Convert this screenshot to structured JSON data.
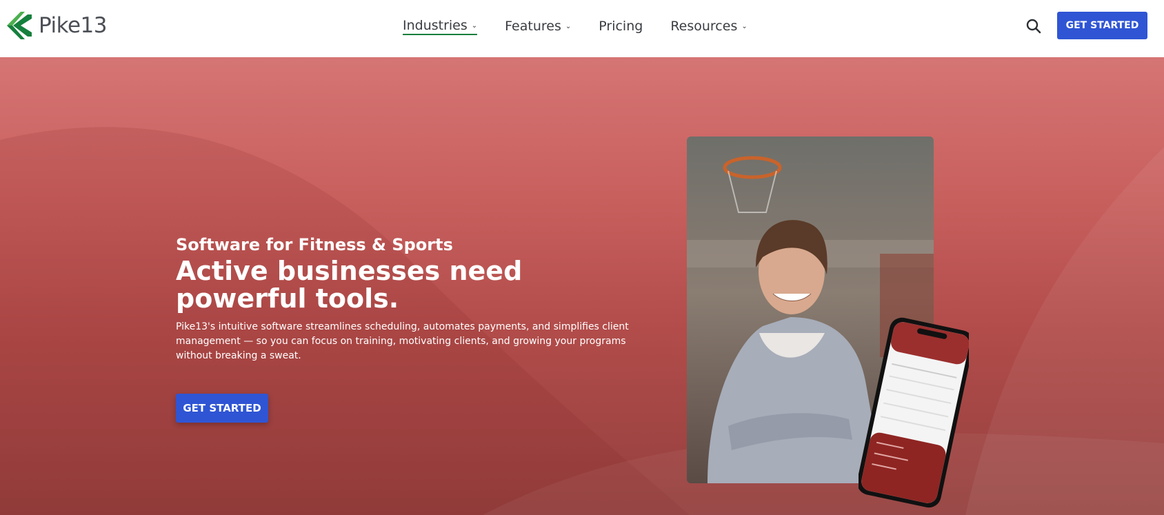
{
  "brand": {
    "name": "Pike13",
    "colors": {
      "green": "#15803d",
      "lightgreen": "#4caf50",
      "blue": "#2f55d4"
    }
  },
  "nav": {
    "items": [
      {
        "label": "Industries",
        "has_dropdown": true,
        "active": true
      },
      {
        "label": "Features",
        "has_dropdown": true,
        "active": false
      },
      {
        "label": "Pricing",
        "has_dropdown": false,
        "active": false
      },
      {
        "label": "Resources",
        "has_dropdown": true,
        "active": false
      }
    ],
    "search_icon": "search-icon",
    "cta": "GET STARTED"
  },
  "hero": {
    "eyebrow": "Software for Fitness & Sports",
    "headline": "Active businesses need powerful tools.",
    "body": "Pike13's intuitive software streamlines scheduling, automates payments, and simplifies client management — so you can focus on training, motivating clients, and growing your programs without breaking a sweat.",
    "cta": "GET STARTED",
    "background_color": "#c25a58"
  }
}
